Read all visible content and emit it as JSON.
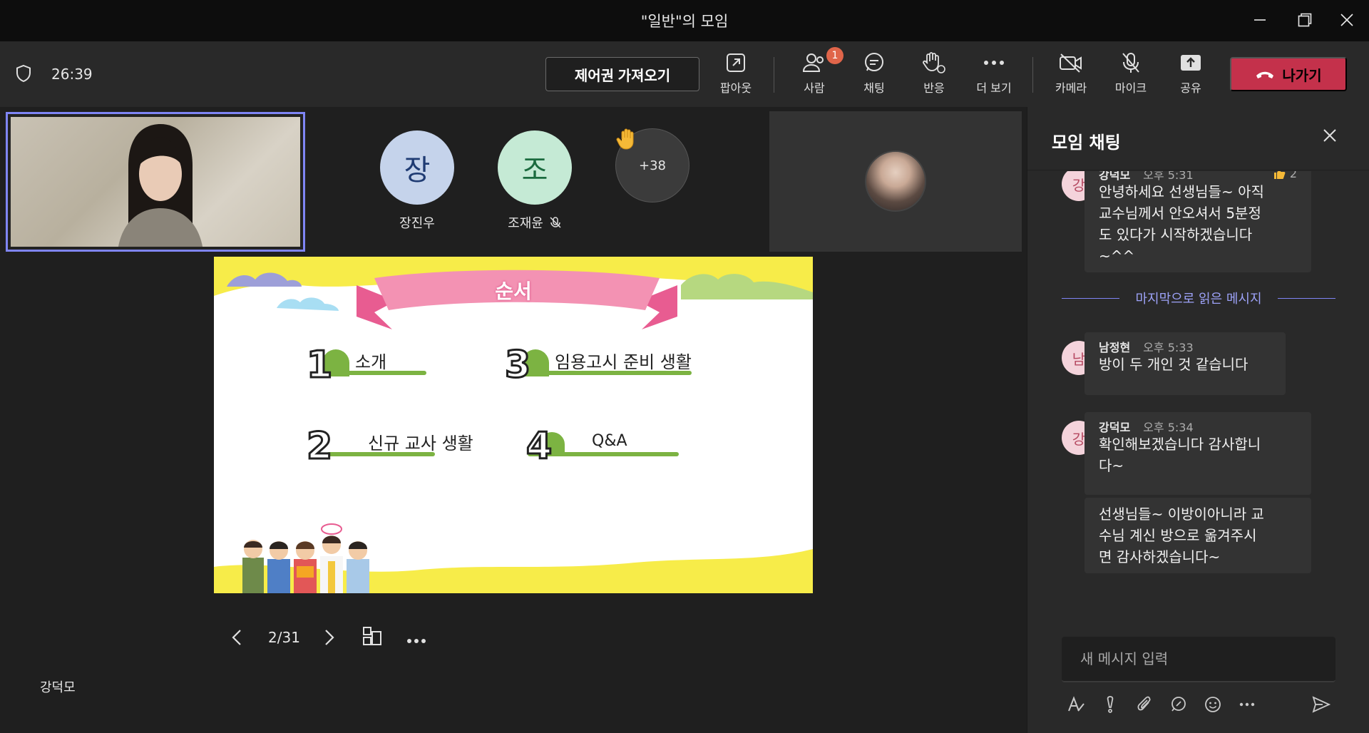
{
  "window": {
    "title": "\"일반\"의 모임"
  },
  "toolbar": {
    "timer": "26:39",
    "take_control": "제어권 가져오기",
    "popout": "팝아웃",
    "people": "사람",
    "people_badge": "1",
    "chat": "채팅",
    "reactions": "반응",
    "more": "더 보기",
    "camera": "카메라",
    "mic": "마이크",
    "share": "공유",
    "leave": "나가기"
  },
  "participants": [
    {
      "initial": "장",
      "name": "장진우",
      "bg": "#c5d3eb",
      "fg": "#1f3b73"
    },
    {
      "initial": "조",
      "name": "조재윤",
      "bg": "#c5ead5",
      "fg": "#1b6b3f"
    }
  ],
  "overflow_count": "+38",
  "slide": {
    "title": "순서",
    "items": [
      {
        "num": "1",
        "label": "소개"
      },
      {
        "num": "3",
        "label": "임용고시 준비 생활"
      },
      {
        "num": "2",
        "label": "신규 교사 생활"
      },
      {
        "num": "4",
        "label": "Q&A"
      }
    ]
  },
  "slide_nav": {
    "page": "2/31"
  },
  "presenter": "강덕모",
  "chat_panel": {
    "title": "모임 채팅",
    "last_read": "마지막으로 읽은 메시지",
    "messages": [
      {
        "initial": "강",
        "author": "강덕모",
        "time": "오후 5:31",
        "reaction": "2",
        "lines": [
          "안녕하세요 선생님들~ 아직",
          "교수님께서 안오셔서 5분정",
          "도 있다가 시작하겠습니다",
          "~^^"
        ]
      },
      {
        "initial": "남",
        "author": "남정현",
        "time": "오후 5:33",
        "lines": [
          "방이 두 개인 것 같습니다"
        ]
      },
      {
        "initial": "강",
        "author": "강덕모",
        "time": "오후 5:34",
        "lines": [
          "확인해보겠습니다 감사합니",
          "다~"
        ]
      },
      {
        "lines": [
          "선생님들~ 이방이아니라 교",
          "수님 계신 방으로 옮겨주시",
          "면 감사하겠습니다~"
        ]
      }
    ],
    "compose_placeholder": "새 메시지 입력"
  },
  "colors": {
    "leave": "#c4314b",
    "accent": "#7f85f5",
    "badge": "#e0654a"
  }
}
